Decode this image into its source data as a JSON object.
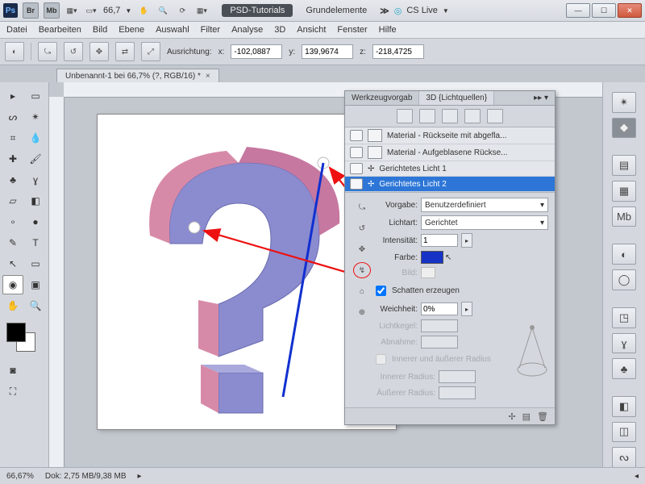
{
  "titlebar": {
    "ps": "Ps",
    "br": "Br",
    "mb": "Mb",
    "zoom": "66,7",
    "wsA": "PSD-Tutorials",
    "wsB": "Grundelemente",
    "cslive": "CS Live"
  },
  "menubar": [
    "Datei",
    "Bearbeiten",
    "Bild",
    "Ebene",
    "Auswahl",
    "Filter",
    "Analyse",
    "3D",
    "Ansicht",
    "Fenster",
    "Hilfe"
  ],
  "optbar": {
    "label_align": "Ausrichtung:",
    "x_lbl": "x:",
    "x": "-102,0887",
    "y_lbl": "y:",
    "y": "139,9674",
    "z_lbl": "z:",
    "z": "-218,4725"
  },
  "doc_tab": {
    "title": "Unbenannt-1 bei 66,7% (?, RGB/16) *"
  },
  "panel": {
    "tab_a": "Werkzeugvorgab",
    "tab_b": "3D {Lichtquellen}",
    "layers": [
      "Material - Rückseite mit abgefla...",
      "Material - Aufgeblasene Rückse...",
      "Gerichtetes Licht 1",
      "Gerichtetes Licht 2"
    ],
    "vorgabe_lbl": "Vorgabe:",
    "vorgabe_val": "Benutzerdefiniert",
    "lichtart_lbl": "Lichtart:",
    "lichtart_val": "Gerichtet",
    "intensitat_lbl": "Intensität:",
    "intensitat_val": "1",
    "farbe_lbl": "Farbe:",
    "farbe_hex": "#1733c6",
    "bild_lbl": "Bild:",
    "schatten_lbl": "Schatten erzeugen",
    "weichheit_lbl": "Weichheit:",
    "weichheit_val": "0%",
    "lichtkegel_lbl": "Lichtkegel:",
    "abnahme_lbl": "Abnahme:",
    "radius_chk": "Innerer und äußerer Radius",
    "inner_lbl": "Innerer Radius:",
    "outer_lbl": "Äußerer Radius:"
  },
  "status": {
    "zoom": "66,67%",
    "doc": "Dok: 2,75 MB/9,38 MB"
  }
}
